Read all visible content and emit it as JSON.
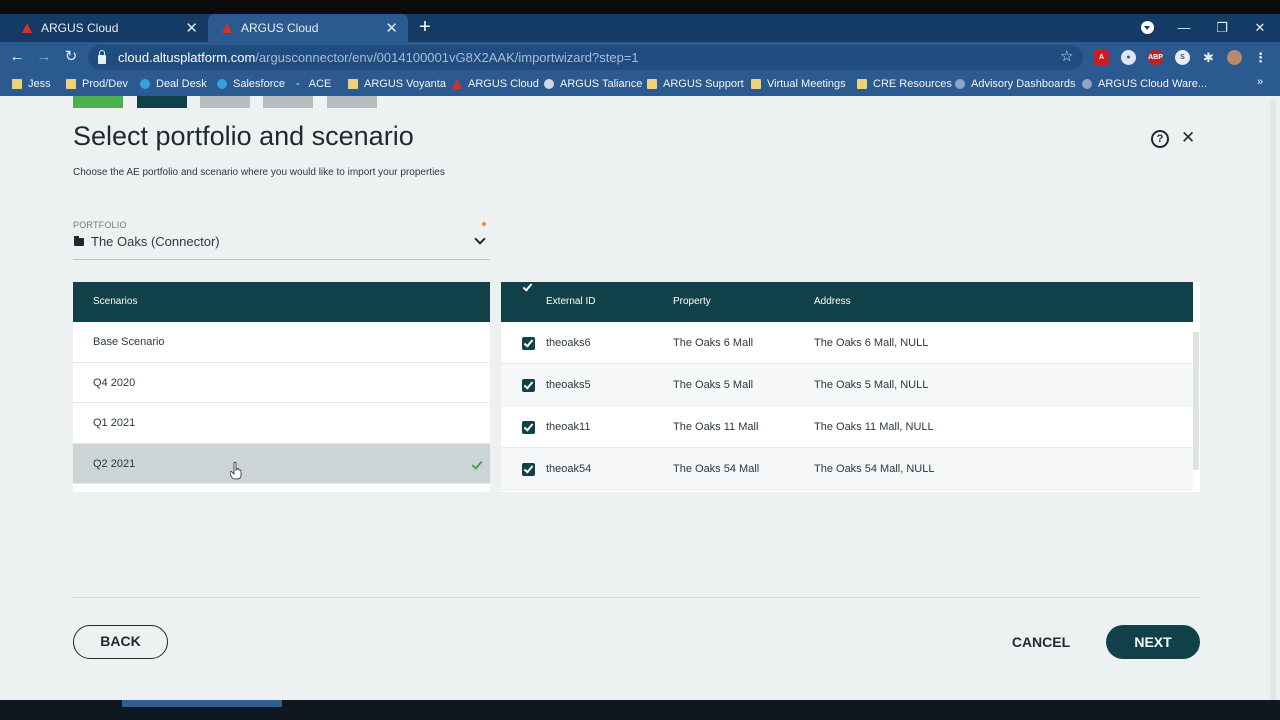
{
  "browser": {
    "tabs": [
      {
        "title": "ARGUS Cloud",
        "active": false
      },
      {
        "title": "ARGUS Cloud",
        "active": true
      }
    ],
    "url_host": "cloud.altusplatform.com",
    "url_path": "/argusconnector/env/0014100001vG8X2AAK/importwizard?step=1",
    "bookmarks": [
      "Jess",
      "Prod/Dev",
      "Deal Desk",
      "Salesforce",
      "ACE",
      "ARGUS Voyanta",
      "ARGUS Cloud",
      "ARGUS Taliance",
      "ARGUS Support",
      "Virtual Meetings",
      "CRE Resources",
      "Advisory Dashboards",
      "ARGUS Cloud Ware..."
    ],
    "bookmarks_overflow": "»"
  },
  "stepper_colors": [
    "#4caf50",
    "#104149",
    "#b7bec0",
    "#b7bec0",
    "#b7bec0"
  ],
  "page": {
    "title": "Select portfolio and scenario",
    "subtitle": "Choose the AE portfolio and scenario where you would like to import your properties"
  },
  "portfolio": {
    "label": "PORTFOLIO",
    "value": "The Oaks (Connector)"
  },
  "scenarios": {
    "header": "Scenarios",
    "items": [
      {
        "label": "Base Scenario",
        "selected": false
      },
      {
        "label": "Q4 2020",
        "selected": false
      },
      {
        "label": "Q1 2021",
        "selected": false
      },
      {
        "label": "Q2 2021",
        "selected": true
      }
    ]
  },
  "properties": {
    "columns": [
      "External ID",
      "Property",
      "Address"
    ],
    "rows": [
      {
        "id": "theoaks6",
        "property": "The Oaks 6 Mall",
        "address": "The Oaks 6 Mall, NULL",
        "checked": true
      },
      {
        "id": "theoaks5",
        "property": "The Oaks 5 Mall",
        "address": "The Oaks 5 Mall, NULL",
        "checked": true
      },
      {
        "id": "theoak11",
        "property": "The Oaks 11 Mall",
        "address": "The Oaks 11 Mall, NULL",
        "checked": true
      },
      {
        "id": "theoak54",
        "property": "The Oaks 54 Mall",
        "address": "The Oaks 54 Mall, NULL",
        "checked": true
      }
    ]
  },
  "footer": {
    "back": "BACK",
    "cancel": "CANCEL",
    "next": "NEXT"
  },
  "colors": {
    "accent_dark": "#104149",
    "success": "#4caf50",
    "required": "#f08a24"
  }
}
